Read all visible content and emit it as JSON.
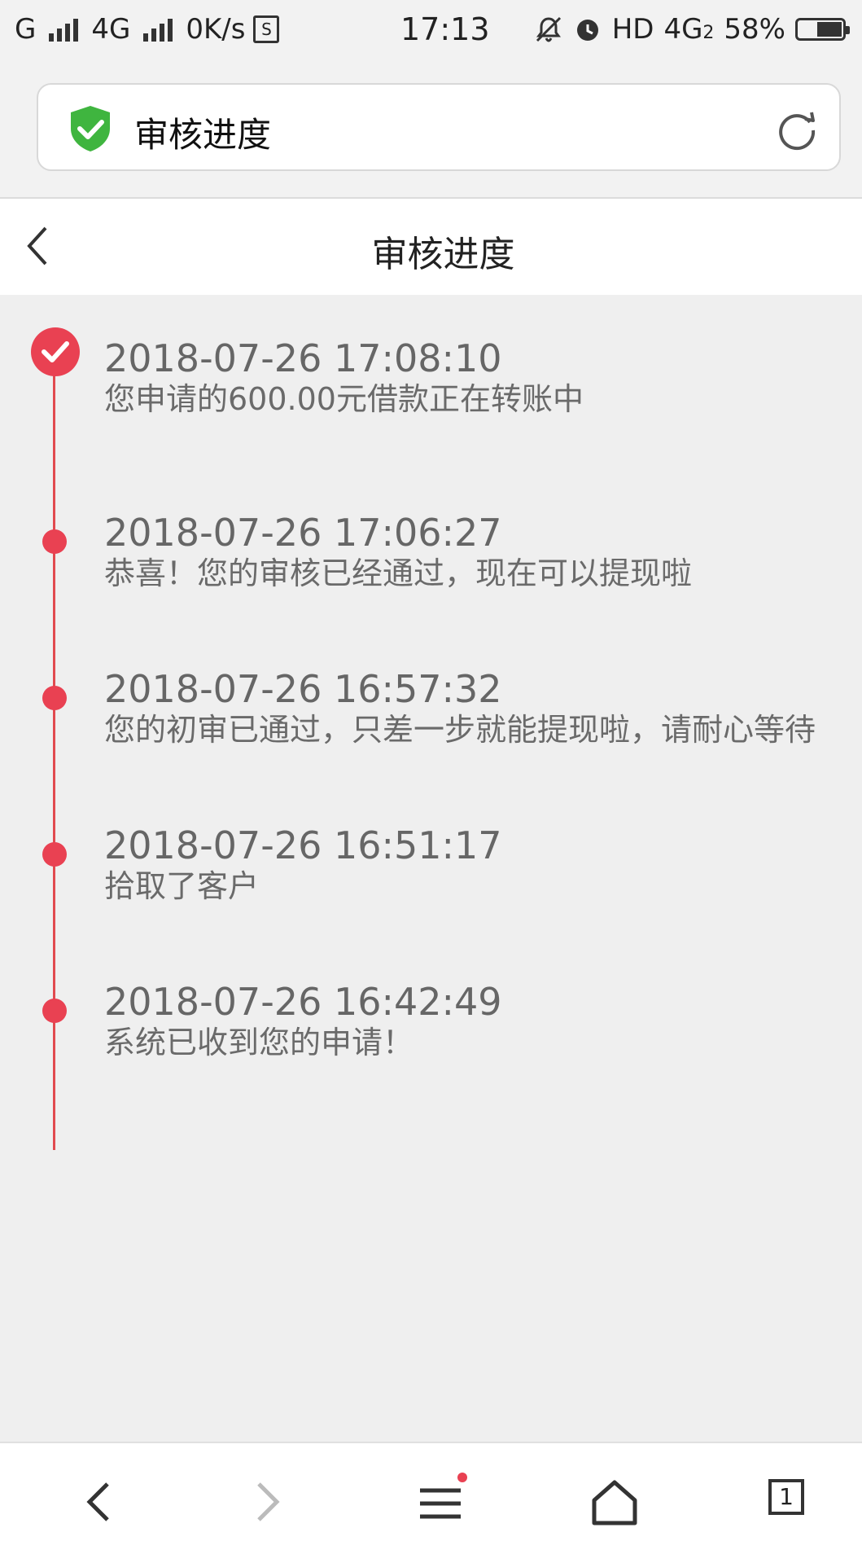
{
  "status": {
    "left": {
      "carrier1": "G",
      "carrier2": "4G",
      "speed": "0K/s",
      "sbox": "S"
    },
    "time": "17:13",
    "right": {
      "hd": "HD",
      "net": "4G",
      "net_sub": "2",
      "battery": "58%"
    }
  },
  "urlbar": {
    "title": "审核进度",
    "icons": {
      "shield": "shield-check-icon",
      "refresh": "refresh-icon"
    }
  },
  "navbar": {
    "title": "审核进度",
    "back_icon": "chevron-left-icon"
  },
  "timeline": {
    "accent_color": "#e94152",
    "entries": [
      {
        "time": "2018-07-26 17:08:10",
        "message": "您申请的600.00元借款正在转账中"
      },
      {
        "time": "2018-07-26 17:06:27",
        "message": "恭喜！您的审核已经通过，现在可以提现啦"
      },
      {
        "time": "2018-07-26 16:57:32",
        "message": "您的初审已通过，只差一步就能提现啦，请耐心等待"
      },
      {
        "time": "2018-07-26 16:51:17",
        "message": "拾取了客户"
      },
      {
        "time": "2018-07-26 16:42:49",
        "message": "系统已收到您的申请！"
      }
    ]
  },
  "bottombar": {
    "tab_count": "1",
    "icons": [
      "back-icon",
      "forward-icon",
      "menu-icon",
      "home-icon",
      "tabs-icon"
    ]
  }
}
